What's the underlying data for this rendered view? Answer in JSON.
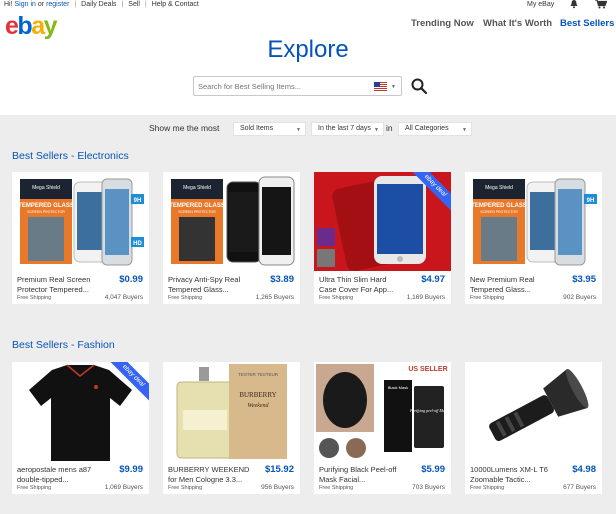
{
  "topbar": {
    "greeting": "Hi!",
    "sign_in": "Sign in",
    "or": "or",
    "register": "register",
    "daily_deals": "Daily Deals",
    "sell": "Sell",
    "help": "Help & Contact",
    "my_ebay": "My eBay"
  },
  "header": {
    "logo": "ebay",
    "nav": [
      "Trending Now",
      "What It's Worth",
      "Best Sellers"
    ],
    "active_nav": "Best Sellers",
    "title": "Explore"
  },
  "search": {
    "placeholder": "Search for Best Selling Items...",
    "region_icon": "us-flag-icon"
  },
  "filters": {
    "prefix": "Show me the most",
    "sort": "Sold Items",
    "period": "In the last 7 days",
    "in_label": "in",
    "category": "All Categories"
  },
  "sections": [
    {
      "title": "Best Sellers - Electronics",
      "items": [
        {
          "name": "Premium Real Screen Protector Tempered...",
          "price": "$0.99",
          "shipping": "Free Shipping",
          "buyers": "4,047 Buyers",
          "badge": ""
        },
        {
          "name": "Privacy Anti-Spy Real Tempered Glass...",
          "price": "$3.89",
          "shipping": "Free Shipping",
          "buyers": "1,265 Buyers",
          "badge": ""
        },
        {
          "name": "Ultra Thin Slim Hard Case Cover For App...",
          "price": "$4.97",
          "shipping": "Free Shipping",
          "buyers": "1,169 Buyers",
          "badge": "ebay deal"
        },
        {
          "name": "New Premium Real Tempered Glass...",
          "price": "$3.95",
          "shipping": "Free Shipping",
          "buyers": "902 Buyers",
          "badge": ""
        }
      ]
    },
    {
      "title": "Best Sellers - Fashion",
      "items": [
        {
          "name": "aeropostale mens a87 double-tipped...",
          "price": "$9.99",
          "shipping": "Free Shipping",
          "buyers": "1,069 Buyers",
          "badge": "ebay deal"
        },
        {
          "name": "BURBERRY WEEKEND for Men Cologne 3.3...",
          "price": "$15.92",
          "shipping": "Free Shipping",
          "buyers": "956 Buyers",
          "badge": ""
        },
        {
          "name": "Purifying Black Peel-off Mask Facial...",
          "price": "$5.99",
          "shipping": "Free Shipping",
          "buyers": "703 Buyers",
          "badge": ""
        },
        {
          "name": "10000Lumens XM-L T6 Zoomable Tactic...",
          "price": "$4.98",
          "shipping": "Free Shipping",
          "buyers": "677 Buyers",
          "badge": ""
        }
      ]
    }
  ],
  "image_text": {
    "glass_brand": "Mega Shield",
    "glass_title": "TEMPERED GLASS",
    "glass_sub": "SCREEN PROTECTOR",
    "glass_9h": "9H",
    "glass_hd": "HD",
    "perfume_tester": "TESTER TESTEUR",
    "perfume_brand": "BURBERRY",
    "perfume_sub": "Weekend",
    "mask_banner": "US SELLER",
    "mask_tube_title": "Black Mask",
    "mask_tube_text": "Purifying peel-off Mask"
  },
  "colors": {
    "brand_blue": "#0654ba",
    "content_bg": "#ededed",
    "badge_blue": "#3665f3"
  }
}
